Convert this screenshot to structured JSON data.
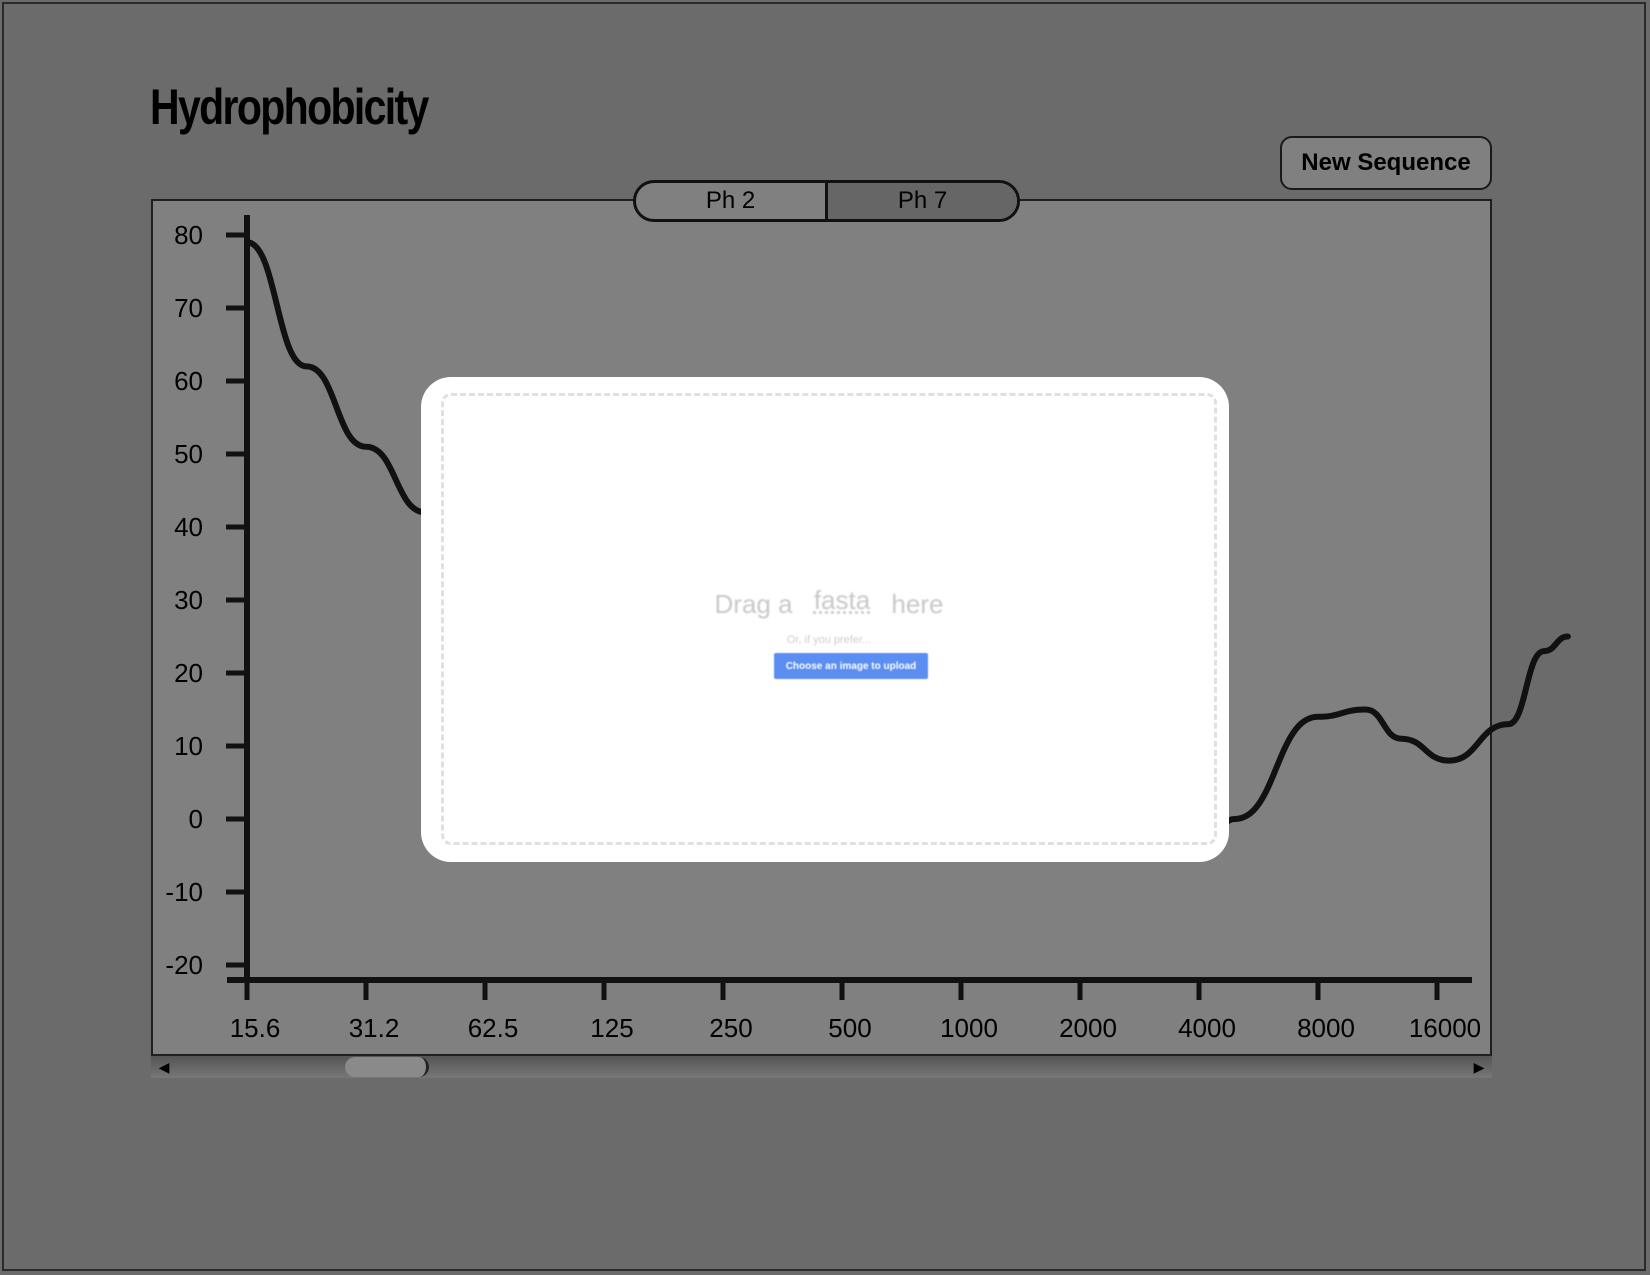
{
  "title": "Hydrophobicity",
  "new_sequence_label": "New Sequence",
  "tabs": [
    {
      "label": "Ph 2",
      "active": false
    },
    {
      "label": "Ph 7",
      "active": true
    }
  ],
  "modal": {
    "drag_prefix": "Drag a",
    "drag_word": "fasta",
    "drag_suffix": "here",
    "alt_text": "Or, if you prefer...",
    "upload_label": "Choose an image to upload"
  },
  "chart_data": {
    "type": "line",
    "title": "",
    "xlabel": "",
    "ylabel": "",
    "x_categories": [
      "15.6",
      "31.2",
      "62.5",
      "125",
      "250",
      "500",
      "1000",
      "2000",
      "4000",
      "8000",
      "16000"
    ],
    "y_ticks": [
      "80",
      "70",
      "60",
      "50",
      "40",
      "30",
      "20",
      "10",
      "0",
      "-10",
      "-20"
    ],
    "ylim": [
      -20,
      80
    ],
    "grid": false,
    "series": [
      {
        "name": "",
        "points": [
          [
            0.0,
            79
          ],
          [
            0.5,
            62
          ],
          [
            1.0,
            51
          ],
          [
            1.5,
            42
          ],
          [
            8.0,
            -5
          ],
          [
            8.3,
            0
          ],
          [
            9.0,
            14
          ],
          [
            9.4,
            15
          ],
          [
            9.7,
            11
          ],
          [
            10.1,
            8
          ],
          [
            10.6,
            13
          ],
          [
            10.9,
            23
          ],
          [
            11.1,
            25
          ]
        ]
      }
    ]
  }
}
